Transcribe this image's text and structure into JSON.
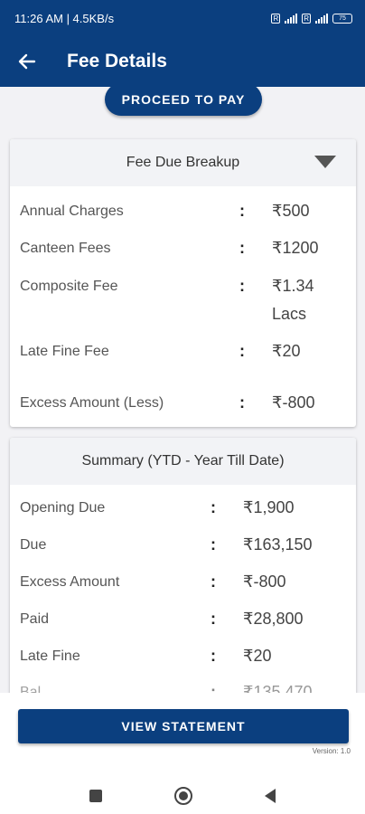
{
  "status_bar": {
    "time_speed": "11:26 AM | 4.5KB/s",
    "sim1": "R",
    "sim2": "R",
    "battery": "75"
  },
  "app_bar": {
    "title": "Fee Details",
    "back_icon": "arrow-left-icon"
  },
  "proceed_button": "PROCEED TO PAY",
  "fee_due_breakup": {
    "header": "Fee Due Breakup",
    "toggle_icon": "triangle-down-icon",
    "rows": [
      {
        "label": "Annual Charges",
        "colon": ":",
        "value": "₹500"
      },
      {
        "label": "Canteen Fees",
        "colon": ":",
        "value": "₹1200"
      },
      {
        "label": "Composite Fee",
        "colon": ":",
        "value": "₹1.34 Lacs"
      },
      {
        "label": "Late Fine Fee",
        "colon": ":",
        "value": "₹20"
      },
      {
        "label": "Excess Amount (Less)",
        "colon": ":",
        "value": "₹-800"
      }
    ]
  },
  "summary": {
    "header": "Summary (YTD - Year Till Date)",
    "rows": [
      {
        "label": "Opening Due",
        "colon": ":",
        "value": "₹1,900"
      },
      {
        "label": "Due",
        "colon": ":",
        "value": "₹163,150"
      },
      {
        "label": "Excess Amount",
        "colon": ":",
        "value": "₹-800"
      },
      {
        "label": "Paid",
        "colon": ":",
        "value": "₹28,800"
      },
      {
        "label": "Late Fine",
        "colon": ":",
        "value": "₹20"
      },
      {
        "label": "Bal",
        "colon": ":",
        "value": "₹135,470"
      }
    ]
  },
  "view_statement_button": "VIEW STATEMENT",
  "version": "Version: 1.0",
  "colors": {
    "primary": "#0b3f7f",
    "card_header_bg": "#f2f3f6",
    "content_bg": "#f2f2f5"
  }
}
